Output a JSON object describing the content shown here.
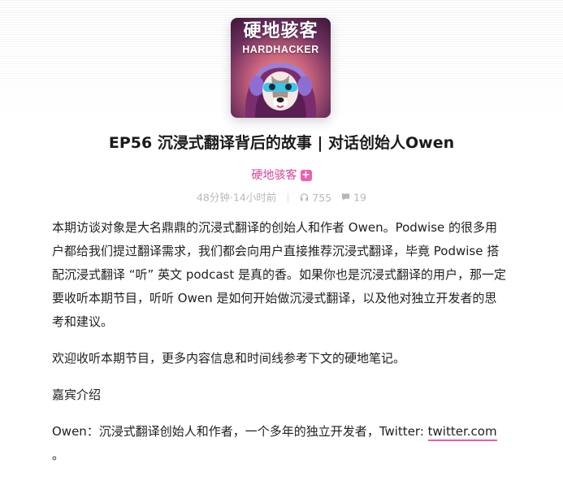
{
  "cover": {
    "title_cn": "硬地骇客",
    "title_en": "HARDHACKER"
  },
  "episode": {
    "title": "EP56 沉浸式翻译背后的故事 | 对话创始人Owen"
  },
  "podcast": {
    "name": "硬地骇客",
    "follow_label": "+"
  },
  "meta": {
    "duration_time": "48分钟·14小时前",
    "plays": "755",
    "comments": "19"
  },
  "content": {
    "para1": "本期访谈对象是大名鼎鼎的沉浸式翻译的创始人和作者 Owen。Podwise 的很多用户都给我们提过翻译需求，我们都会向用户直接推荐沉浸式翻译，毕竟 Podwise 搭配沉浸式翻译 “听” 英文 podcast 是真的香。如果你也是沉浸式翻译的用户，那一定要收听本期节目，听听 Owen 是如何开始做沉浸式翻译，以及他对独立开发者的思考和建议。",
    "para2": "欢迎收听本期节目，更多内容信息和时间线参考下文的硬地笔记。",
    "para3": "嘉宾介绍",
    "para4_prefix": "Owen：沉浸式翻译创始人和作者，一个多年的独立开发者，Twitter: ",
    "para4_link": "twitter.com",
    "para4_suffix": " 。"
  },
  "colors": {
    "accent": "#d5449a",
    "plus_bg": "#ee5fae",
    "link_underline": "#ec5ba7",
    "meta_text": "#b8b8b8"
  },
  "icons": {
    "plays": "headphones-icon",
    "comments": "comment-icon"
  }
}
